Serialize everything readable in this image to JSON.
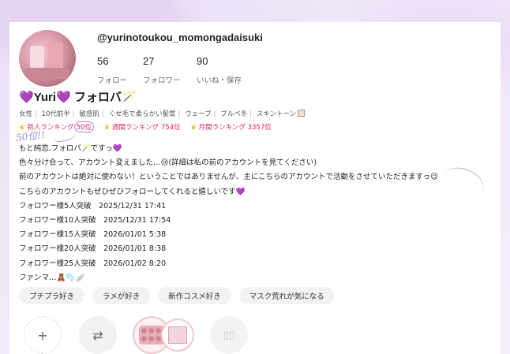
{
  "profile": {
    "username": "@yurinotoukou_momongadaisuki",
    "display_name_pre": "💜",
    "display_name_main": "Yuri",
    "display_name_post": "💜 フォロバ🪄",
    "stats": [
      {
        "value": "56",
        "label": "フォロー"
      },
      {
        "value": "27",
        "label": "フォロワー"
      },
      {
        "value": "90",
        "label": "いいね・保存"
      }
    ],
    "tags": [
      "女性",
      "10代前半",
      "敏感肌",
      "くせ毛で柔らかい髪質",
      "ウェーブ",
      "ブルベ冬",
      "スキントーン"
    ],
    "rankings": [
      {
        "prefix": "新人ランキング",
        "rank": "50位"
      },
      {
        "prefix": "週間ランキング",
        "rank": "754位"
      },
      {
        "prefix": "月間ランキング",
        "rank": "3357位"
      }
    ],
    "scribble": "50位!!",
    "bio_lines": [
      "もと純恋.フォロバ🪄ですっ💜",
      "色々分け合って、アカウント変えました…😢(詳細は私の前のアカウントを見てください)",
      "前のアカウントは絶対に使わない！ということではありませんが、主にこちらのアカウントで活動をさせていただきますっ😉",
      "こちらのアカウントもぜひぜひフォローしてくれると嬉しいです💜",
      "フォロワー様5人突破　2025/12/31 17:41",
      "フォロワー様10人突破　2025/12/31 17:54",
      "フォロワー様15人突破　2026/01/01  5:38",
      "フォロワー様20人突破　2026/01/01  8:38",
      "フォロワー様25人突破　2026/01/02  8:20",
      "ファンマ…🧸🫧🪽"
    ],
    "interest_chips": [
      "プチプラ好き",
      "ラメが好き",
      "新作コスメ好き",
      "マスク荒れが気になる"
    ]
  },
  "actions": {
    "add_symbol": "+",
    "swap_symbol": "⇄"
  },
  "colors": {
    "accent_purple": "#9a3fc8",
    "rank_red": "#e0245e",
    "crown_gold": "#f0b000"
  }
}
